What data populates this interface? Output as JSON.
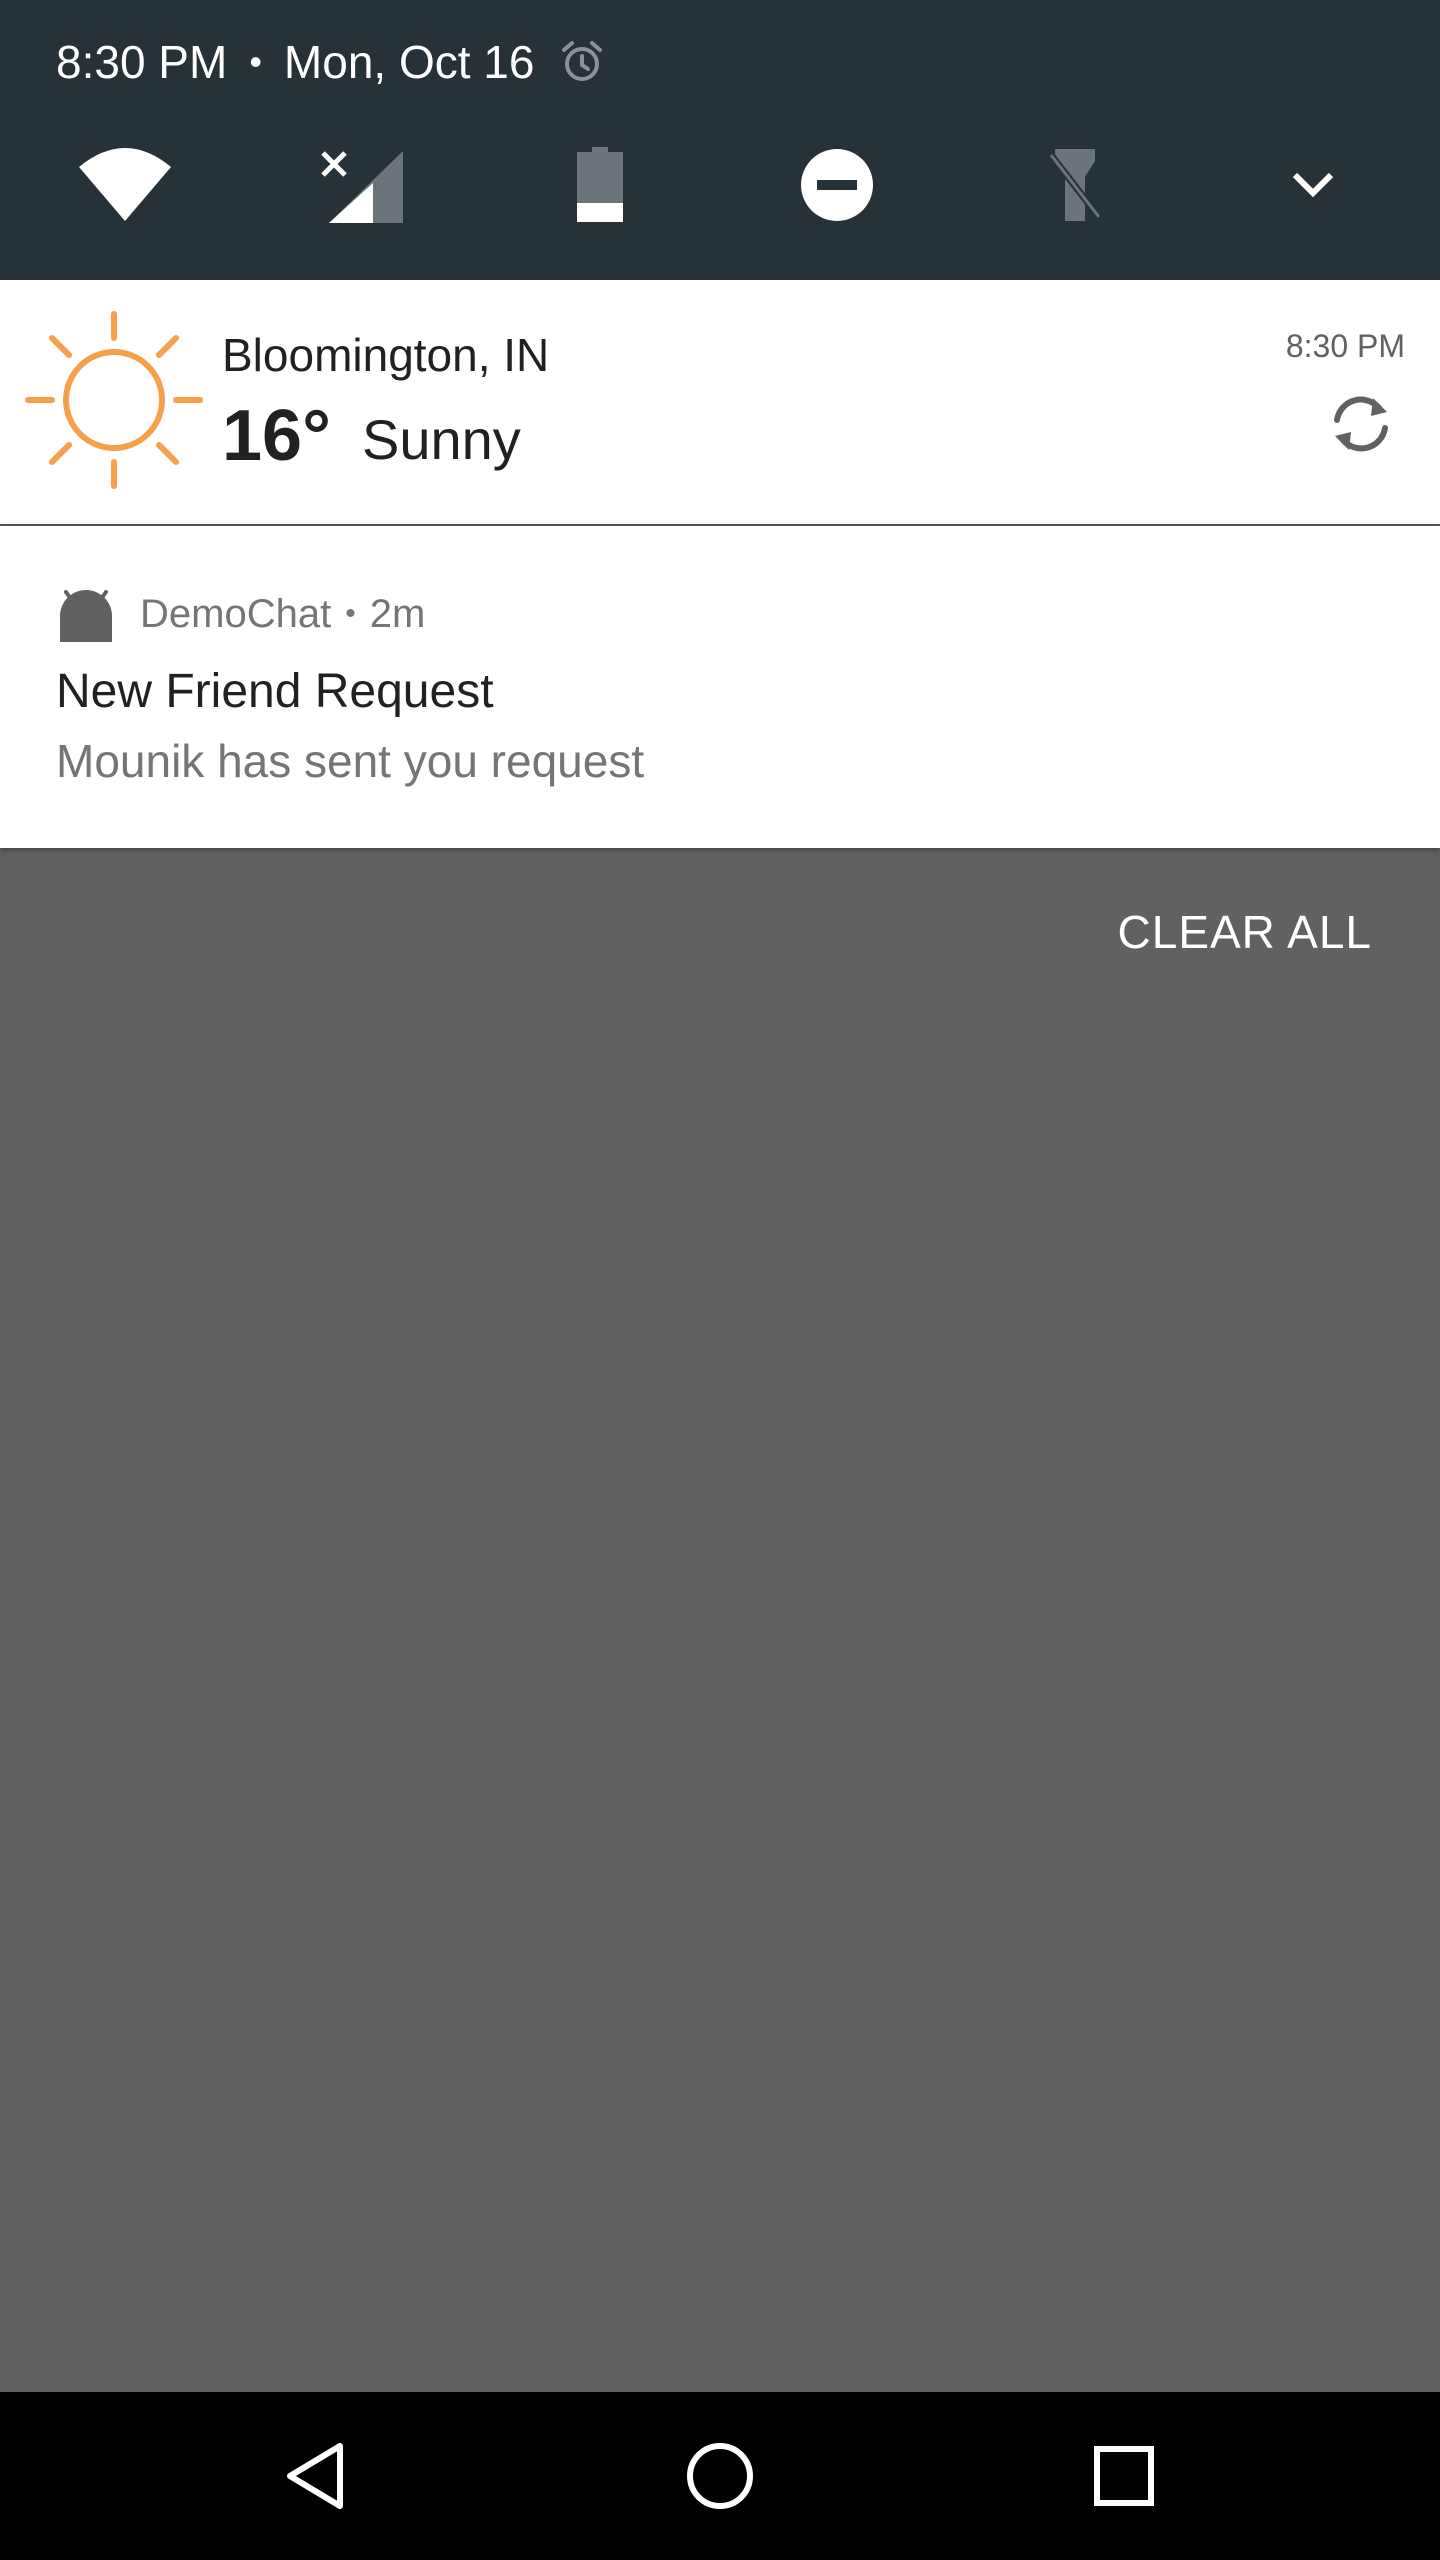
{
  "status": {
    "time": "8:30 PM",
    "separator": "•",
    "date": "Mon, Oct 16"
  },
  "quick_settings": {
    "tiles": [
      "wifi-icon",
      "signal-no-service-icon",
      "battery-icon",
      "do-not-disturb-icon",
      "flashlight-off-icon",
      "expand-chevron-icon"
    ]
  },
  "weather": {
    "location": "Bloomington, IN",
    "temperature": "16°",
    "condition": "Sunny",
    "updated": "8:30 PM",
    "sun_color": "#F7A04B"
  },
  "notification": {
    "app_name": "DemoChat",
    "separator": "•",
    "age": "2m",
    "title": "New Friend Request",
    "body": "Mounik has sent you request"
  },
  "actions": {
    "clear_all": "CLEAR ALL"
  },
  "nav": {
    "buttons": [
      "back-icon",
      "home-icon",
      "recents-icon"
    ]
  }
}
